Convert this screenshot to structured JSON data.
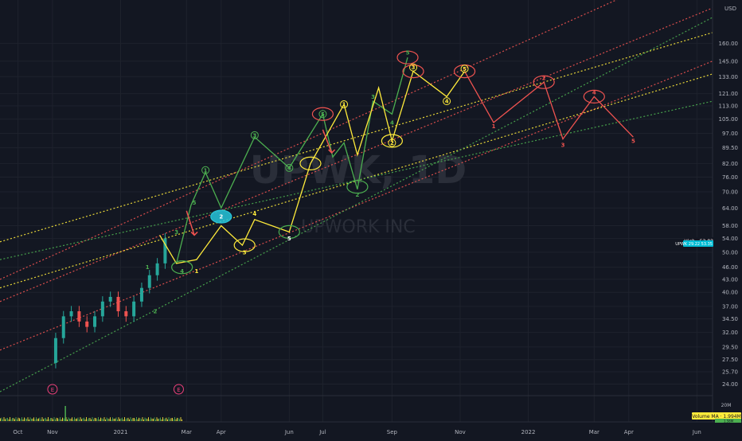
{
  "chart_data": {
    "type": "line",
    "symbol": "UPWK, 1D",
    "company": "UPWORK INC",
    "currency": "USD",
    "y_scale": "log",
    "ylim": [
      22.5,
      195
    ],
    "xlim": [
      "2020-09-15",
      "2022-06-15"
    ],
    "y_ticks": [
      "24.00",
      "25.70",
      "27.50",
      "29.50",
      "32.00",
      "34.50",
      "37.00",
      "40.00",
      "43.00",
      "46.00",
      "50.00",
      "54.00",
      "58.00",
      "64.00",
      "70.00",
      "76.00",
      "82.00",
      "89.50",
      "97.00",
      "105.00",
      "113.00",
      "121.00",
      "133.00",
      "145.00",
      "160.00"
    ],
    "y_tick_values": [
      24,
      25.7,
      27.5,
      29.5,
      32,
      34.5,
      37,
      40,
      43,
      46,
      50,
      54,
      58,
      64,
      70,
      76,
      82,
      89.5,
      97,
      105,
      113,
      121,
      133,
      145,
      160
    ],
    "x_ticks": [
      {
        "label": "Oct",
        "date": "2020-10-01"
      },
      {
        "label": "Nov",
        "date": "2020-11-01"
      },
      {
        "label": "2021",
        "date": "2021-01-01"
      },
      {
        "label": "Mar",
        "date": "2021-03-01"
      },
      {
        "label": "Apr",
        "date": "2021-04-01"
      },
      {
        "label": "Jun",
        "date": "2021-06-01"
      },
      {
        "label": "Jul",
        "date": "2021-07-01"
      },
      {
        "label": "Sep",
        "date": "2021-09-01"
      },
      {
        "label": "Nov",
        "date": "2021-11-01"
      },
      {
        "label": "2022",
        "date": "2022-01-01"
      },
      {
        "label": "Mar",
        "date": "2022-03-01"
      },
      {
        "label": "Apr",
        "date": "2022-04-01"
      },
      {
        "label": "Jun",
        "date": "2022-06-01"
      }
    ],
    "price_series": {
      "x": [
        "2020-11-01",
        "2020-11-08",
        "2020-11-15",
        "2020-11-22",
        "2020-11-29",
        "2020-12-06",
        "2020-12-13",
        "2020-12-20",
        "2020-12-27",
        "2021-01-03",
        "2021-01-10",
        "2021-01-17",
        "2021-01-24",
        "2021-01-31",
        "2021-02-07",
        "2021-02-14"
      ],
      "y": [
        27,
        31,
        35,
        36,
        34,
        33,
        35,
        38,
        39,
        36,
        35,
        38,
        41,
        44,
        47,
        54
      ]
    },
    "price_labels": {
      "high": "High · 53.83",
      "last": "UPWK  29.22  53.35"
    },
    "volume": {
      "ma_label": "Volume MA · 1.994M",
      "label2": "1.58M",
      "scale_label": "20M"
    },
    "earnings_markers": [
      {
        "date": "2020-11-01",
        "label": "E"
      },
      {
        "date": "2021-02-22",
        "label": "E"
      }
    ],
    "trendlines": [
      {
        "color": "#ef5350",
        "points": [
          [
            "2020-09-15",
            43
          ],
          [
            "2022-06-15",
            260
          ]
        ]
      },
      {
        "color": "#ef5350",
        "points": [
          [
            "2020-09-15",
            38
          ],
          [
            "2022-06-15",
            195
          ]
        ]
      },
      {
        "color": "#ef5350",
        "points": [
          [
            "2020-09-15",
            29
          ],
          [
            "2022-06-15",
            145
          ]
        ]
      },
      {
        "color": "#ffeb3b",
        "points": [
          [
            "2020-09-15",
            53
          ],
          [
            "2022-06-15",
            170
          ]
        ]
      },
      {
        "color": "#ffeb3b",
        "points": [
          [
            "2020-09-15",
            41
          ],
          [
            "2022-06-15",
            135
          ]
        ]
      },
      {
        "color": "#4caf50",
        "points": [
          [
            "2020-09-15",
            48
          ],
          [
            "2022-06-15",
            116
          ]
        ]
      },
      {
        "color": "#4caf50",
        "points": [
          [
            "2020-09-15",
            23
          ],
          [
            "2022-06-15",
            185
          ]
        ]
      }
    ],
    "wave_paths": [
      {
        "name": "green",
        "color": "#4caf50",
        "points": [
          [
            "2021-02-20",
            47
          ],
          [
            "2021-03-05",
            65
          ],
          [
            "2021-03-18",
            78
          ],
          [
            "2021-04-01",
            64
          ],
          [
            "2021-05-01",
            95
          ],
          [
            "2021-06-01",
            80
          ],
          [
            "2021-07-01",
            108
          ],
          [
            "2021-07-10",
            85
          ],
          [
            "2021-07-20",
            92
          ],
          [
            "2021-08-01",
            71
          ],
          [
            "2021-08-15",
            116
          ],
          [
            "2021-09-01",
            108
          ],
          [
            "2021-09-15",
            148
          ]
        ]
      },
      {
        "name": "yellow",
        "color": "#ffeb3b",
        "points": [
          [
            "2021-02-05",
            55
          ],
          [
            "2021-02-20",
            47
          ],
          [
            "2021-03-10",
            48
          ],
          [
            "2021-04-01",
            58
          ],
          [
            "2021-04-20",
            52
          ],
          [
            "2021-05-01",
            60
          ],
          [
            "2021-06-01",
            56
          ],
          [
            "2021-06-20",
            82
          ],
          [
            "2021-07-20",
            114
          ],
          [
            "2021-08-01",
            86
          ],
          [
            "2021-08-20",
            125
          ],
          [
            "2021-09-01",
            93
          ],
          [
            "2021-09-20",
            137
          ],
          [
            "2021-10-20",
            119
          ],
          [
            "2021-11-05",
            137
          ]
        ]
      },
      {
        "name": "red",
        "color": "#ef5350",
        "points": [
          [
            "2021-11-05",
            137
          ],
          [
            "2021-12-01",
            103
          ],
          [
            "2022-01-15",
            129
          ],
          [
            "2022-02-01",
            94
          ],
          [
            "2022-03-01",
            119
          ],
          [
            "2022-04-05",
            95
          ]
        ]
      }
    ],
    "wave_labels": [
      {
        "text": "1",
        "color": "#4caf50",
        "date": "2021-01-25",
        "price": 46,
        "circled": false
      },
      {
        "text": "2",
        "color": "#4caf50",
        "date": "2021-02-01",
        "price": 36,
        "circled": false
      },
      {
        "text": "3",
        "color": "#4caf50",
        "date": "2021-02-20",
        "price": 56,
        "circled": false
      },
      {
        "text": "4",
        "color": "#4caf50",
        "date": "2021-02-25",
        "price": 45,
        "circled": false
      },
      {
        "text": "5",
        "color": "#4caf50",
        "date": "2021-03-08",
        "price": 66,
        "circled": false
      },
      {
        "text": "1",
        "color": "#ffeb3b",
        "date": "2021-03-10",
        "price": 45,
        "circled": false
      },
      {
        "text": "1",
        "color": "#4caf50",
        "date": "2021-03-18",
        "price": 79,
        "circled": true
      },
      {
        "text": "2",
        "color": "#ffffff",
        "date": "2021-04-01",
        "price": 61,
        "circled": false
      },
      {
        "text": "3",
        "color": "#4caf50",
        "date": "2021-05-01",
        "price": 96,
        "circled": true
      },
      {
        "text": "3",
        "color": "#ffeb3b",
        "date": "2021-04-22",
        "price": 50,
        "circled": false
      },
      {
        "text": "4",
        "color": "#ffeb3b",
        "date": "2021-05-01",
        "price": 62,
        "circled": false
      },
      {
        "text": "4",
        "color": "#4caf50",
        "date": "2021-06-01",
        "price": 80,
        "circled": true
      },
      {
        "text": "5",
        "color": "#ffffff",
        "date": "2021-06-01",
        "price": 54,
        "circled": false
      },
      {
        "text": "5",
        "color": "#4caf50",
        "date": "2021-07-01",
        "price": 108,
        "circled": true
      },
      {
        "text": "1",
        "color": "#ffeb3b",
        "date": "2021-07-20",
        "price": 114,
        "circled": true
      },
      {
        "text": "3",
        "color": "#4caf50",
        "date": "2021-08-15",
        "price": 119,
        "circled": false
      },
      {
        "text": "2",
        "color": "#4caf50",
        "date": "2021-08-01",
        "price": 69,
        "circled": false
      },
      {
        "text": "4",
        "color": "#4caf50",
        "date": "2021-09-01",
        "price": 103,
        "circled": false
      },
      {
        "text": "2",
        "color": "#ffeb3b",
        "date": "2021-09-01",
        "price": 92,
        "circled": true
      },
      {
        "text": "5",
        "color": "#4caf50",
        "date": "2021-09-15",
        "price": 152,
        "circled": false
      },
      {
        "text": "3",
        "color": "#ffeb3b",
        "date": "2021-09-20",
        "price": 140,
        "circled": true
      },
      {
        "text": "4",
        "color": "#ffeb3b",
        "date": "2021-10-20",
        "price": 116,
        "circled": true
      },
      {
        "text": "5",
        "color": "#ffeb3b",
        "date": "2021-11-05",
        "price": 139,
        "circled": true
      },
      {
        "text": "1",
        "color": "#ef5350",
        "date": "2021-12-01",
        "price": 101,
        "circled": false
      },
      {
        "text": "2",
        "color": "#ef5350",
        "date": "2022-01-15",
        "price": 132,
        "circled": false
      },
      {
        "text": "3",
        "color": "#ef5350",
        "date": "2022-02-01",
        "price": 91,
        "circled": false
      },
      {
        "text": "4",
        "color": "#ef5350",
        "date": "2022-03-01",
        "price": 122,
        "circled": false
      },
      {
        "text": "5",
        "color": "#ef5350",
        "date": "2022-04-05",
        "price": 93,
        "circled": false
      }
    ],
    "ellipses": [
      {
        "date": "2021-02-25",
        "price": 46,
        "color": "#4caf50"
      },
      {
        "date": "2021-04-01",
        "price": 61,
        "color": "#26c6da",
        "fill": true
      },
      {
        "date": "2021-04-22",
        "price": 52,
        "color": "#ffeb3b"
      },
      {
        "date": "2021-06-01",
        "price": 56,
        "color": "#4caf50"
      },
      {
        "date": "2021-06-20",
        "price": 82,
        "color": "#ffeb3b"
      },
      {
        "date": "2021-07-01",
        "price": 108,
        "color": "#ef5350"
      },
      {
        "date": "2021-08-01",
        "price": 72,
        "color": "#4caf50"
      },
      {
        "date": "2021-09-01",
        "price": 93,
        "color": "#ffeb3b"
      },
      {
        "date": "2021-09-15",
        "price": 148,
        "color": "#ef5350"
      },
      {
        "date": "2021-09-20",
        "price": 137,
        "color": "#ef5350"
      },
      {
        "date": "2021-11-05",
        "price": 137,
        "color": "#ef5350"
      },
      {
        "date": "2022-01-15",
        "price": 129,
        "color": "#ef5350"
      },
      {
        "date": "2022-03-01",
        "price": 119,
        "color": "#ef5350"
      }
    ],
    "arrows": [
      {
        "color": "#ef5350",
        "from": [
          "2021-03-01",
          63
        ],
        "to": [
          "2021-03-08",
          55
        ]
      },
      {
        "color": "#ef5350",
        "from": [
          "2021-07-01",
          99
        ],
        "to": [
          "2021-07-09",
          87
        ]
      }
    ],
    "grid": true,
    "colors": {
      "background": "#131722",
      "bull": "#26a69a",
      "bear": "#ef5350",
      "axis_text": "#b2b5be"
    }
  }
}
